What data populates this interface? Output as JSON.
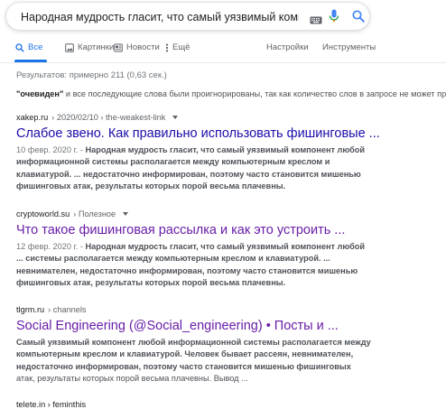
{
  "search": {
    "query": "Народная мудрость гласит, что самый уязвимый компонент любо"
  },
  "tabs": {
    "all": "Все",
    "images": "Картинки",
    "news": "Новости",
    "more": "Ещё",
    "settings": "Настройки",
    "tools": "Инструменты"
  },
  "stats": "Результатов: примерно 211 (0,63 сек.)",
  "notice": {
    "word": "\"очевиден\"",
    "text": " и все последующие слова были проигнорированы, так как количество слов в запросе не может превы"
  },
  "results": [
    {
      "domain": "xakep.ru",
      "path": " › 2020/02/10 › the-weakest-link",
      "title": "Слабое звено. Как правильно использовать фишинговые ...",
      "date": "10 февр. 2020 г. - ",
      "snippet_lines": [
        "Народная мудрость гласит, что самый уязвимый компонент любой",
        "информационной системы располагается между компьютерным креслом и",
        "клавиатурой. ... недостаточно информирован, поэтому часто становится мишенью",
        "фишинговых атак, результаты которых порой весьма плачевны."
      ]
    },
    {
      "domain": "cryptoworld.su",
      "path": " › Полезное",
      "title": "Что такое фишинговая рассылка и как это устроить ...",
      "date": "12 февр. 2020 г. - ",
      "snippet_lines": [
        "Народная мудрость гласит, что самый уязвимый компонент любой",
        "... системы располагается между компьютерным креслом и клавиатурой. ...",
        "невнимателен, недостаточно информирован, поэтому часто становится мишенью",
        "фишинговых атак, результаты которых порой весьма плачевны."
      ]
    },
    {
      "domain": "tlgrm.ru",
      "path": " › channels",
      "title": "Social Engineering (@Social_engineering) • Посты и ...",
      "date": "",
      "snippet_lines": [
        "Самый уязвимый компонент любой информационной системы располагается между",
        "компьютерным креслом и клавиатурой. Человек бывает рассеян, невнимателен,",
        "недостаточно информирован, поэтому часто становится мишенью фишинговых",
        "атак, результаты которых порой весьма плачевны. Вывод ..."
      ]
    }
  ],
  "cut_text": "telete.in › feminthis"
}
